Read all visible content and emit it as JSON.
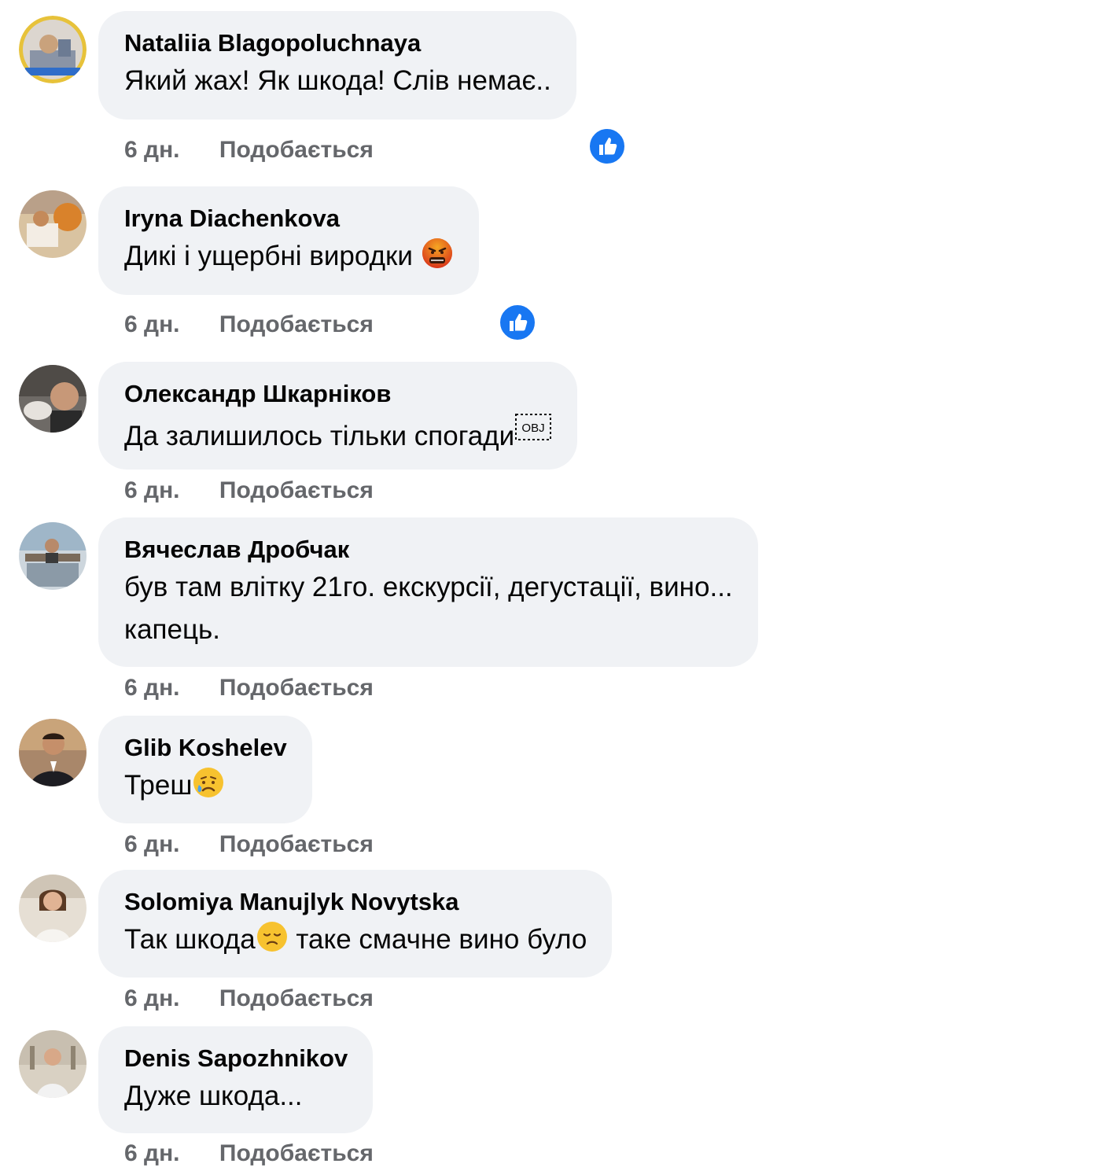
{
  "comments": [
    {
      "author": "Nataliia Blagopoluchnaya",
      "text": "Який жах! Як шкода! Слів немає..",
      "emoji": "",
      "time": "6 дн.",
      "like_label": "Подобається",
      "has_like_reaction": true
    },
    {
      "author": "Iryna Diachenkova",
      "text": "Дикі і ущербні виродки ",
      "emoji": "angry-face-emoji",
      "time": "6 дн.",
      "like_label": "Подобається",
      "has_like_reaction": true
    },
    {
      "author": "Олександр Шкарніков",
      "text": "Да залишилось тільки спогади",
      "emoji": "obj-placeholder",
      "time": "6 дн.",
      "like_label": "Подобається",
      "has_like_reaction": false
    },
    {
      "author": "Вячеслав Дробчак",
      "text": "був там влітку 21го. екскурсії, дегустації, вино...\nкапець.",
      "emoji": "",
      "time": "6 дн.",
      "like_label": "Подобається",
      "has_like_reaction": false
    },
    {
      "author": "Glib Koshelev",
      "text": "Треш",
      "emoji": "crying-face-emoji",
      "time": "6 дн.",
      "like_label": "Подобається",
      "has_like_reaction": false
    },
    {
      "author": "Solomiya Manujlyk Novytska",
      "text": "Так шкода",
      "text_after": " таке смачне вино було",
      "emoji": "sad-face-emoji",
      "time": "6 дн.",
      "like_label": "Подобається",
      "has_like_reaction": false
    },
    {
      "author": "Denis Sapozhnikov",
      "text": "Дуже шкода...",
      "emoji": "",
      "time": "6 дн.",
      "like_label": "Подобається",
      "has_like_reaction": false
    }
  ],
  "colors": {
    "bubble_bg": "#f0f2f5",
    "secondary_text": "#65676b",
    "like_blue": "#1877f2"
  }
}
